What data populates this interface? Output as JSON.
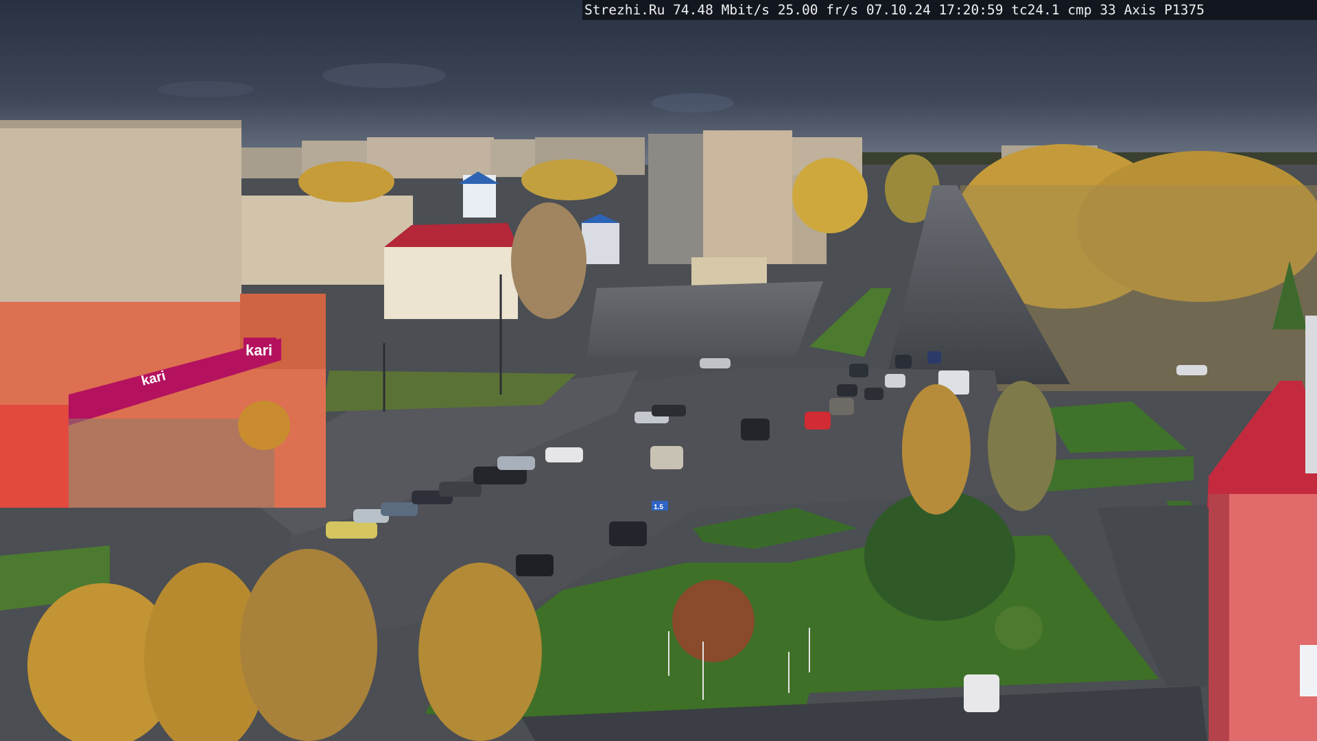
{
  "overlay": {
    "text": "Strezhi.Ru 74.48 Mbit/s 25.00 fr/s 07.10.24 17:20:59  tc24.1  cmp 33   Axis P1375"
  },
  "signs": {
    "store_logo": "kari",
    "banner_text": "kari",
    "road_sign": "1.5"
  },
  "colors": {
    "sky_top": "#2b3445",
    "sky_horizon": "#5b6675",
    "asphalt": "#4a4d52",
    "grass": "#3f6a2a",
    "foliage": "#c59a34",
    "brand_magenta": "#b4125f",
    "facade_orange": "#e0724c"
  }
}
